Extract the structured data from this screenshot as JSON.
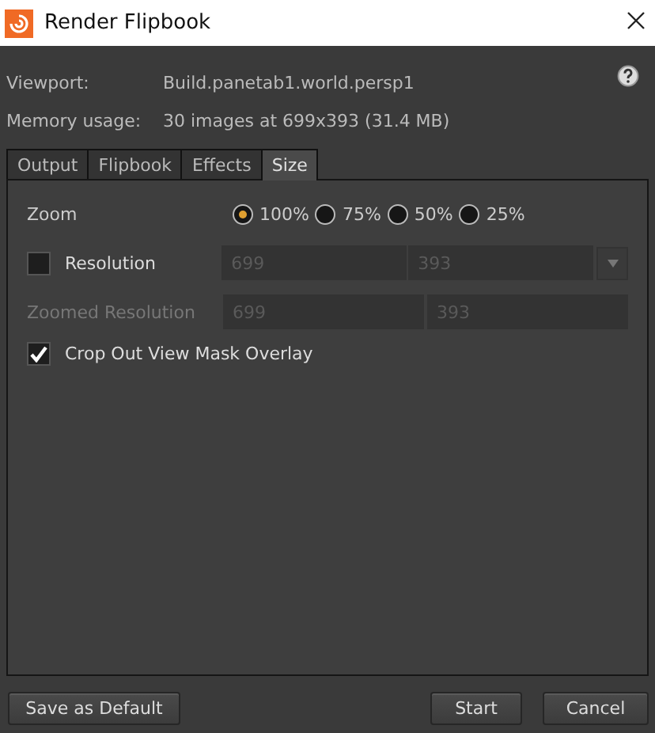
{
  "window": {
    "title": "Render Flipbook"
  },
  "info": [
    {
      "label": "Viewport:",
      "value": "Build.panetab1.world.persp1"
    },
    {
      "label": "Memory usage:",
      "value": "30 images at 699x393 (31.4 MB)"
    }
  ],
  "tabs": [
    {
      "label": "Output",
      "selected": false
    },
    {
      "label": "Flipbook",
      "selected": false
    },
    {
      "label": "Effects",
      "selected": false
    },
    {
      "label": "Size",
      "selected": true
    }
  ],
  "size": {
    "zoom": {
      "label": "Zoom",
      "options": [
        {
          "label": "100%",
          "selected": true
        },
        {
          "label": "75%",
          "selected": false
        },
        {
          "label": "50%",
          "selected": false
        },
        {
          "label": "25%",
          "selected": false
        }
      ]
    },
    "resolution": {
      "label": "Resolution",
      "checked": false,
      "values": [
        "699",
        "393"
      ]
    },
    "zoomed_resolution": {
      "label": "Zoomed Resolution",
      "values": [
        "699",
        "393"
      ]
    },
    "crop": {
      "label": "Crop Out View Mask Overlay",
      "checked": true
    }
  },
  "left_buttons": [
    {
      "label": "Save as Default"
    }
  ],
  "right_buttons": [
    {
      "label": "Start"
    },
    {
      "label": "Cancel"
    }
  ]
}
